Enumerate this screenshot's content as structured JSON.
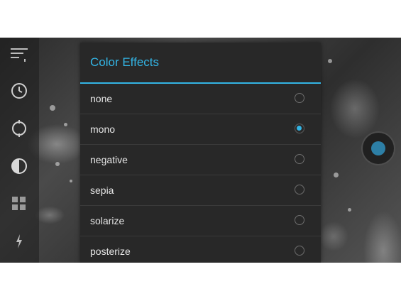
{
  "dialog": {
    "title": "Color Effects",
    "options": [
      {
        "label": "none",
        "selected": false
      },
      {
        "label": "mono",
        "selected": true
      },
      {
        "label": "negative",
        "selected": false
      },
      {
        "label": "sepia",
        "selected": false
      },
      {
        "label": "solarize",
        "selected": false
      },
      {
        "label": "posterize",
        "selected": false
      }
    ]
  },
  "left_rail": {
    "icons": [
      "menu-icon",
      "timer-icon",
      "focus-icon",
      "contrast-icon",
      "grid-icon",
      "flash-icon"
    ]
  },
  "colors": {
    "accent": "#33b5e5",
    "dialog_bg": "#282828",
    "text": "#e6e6e6"
  }
}
